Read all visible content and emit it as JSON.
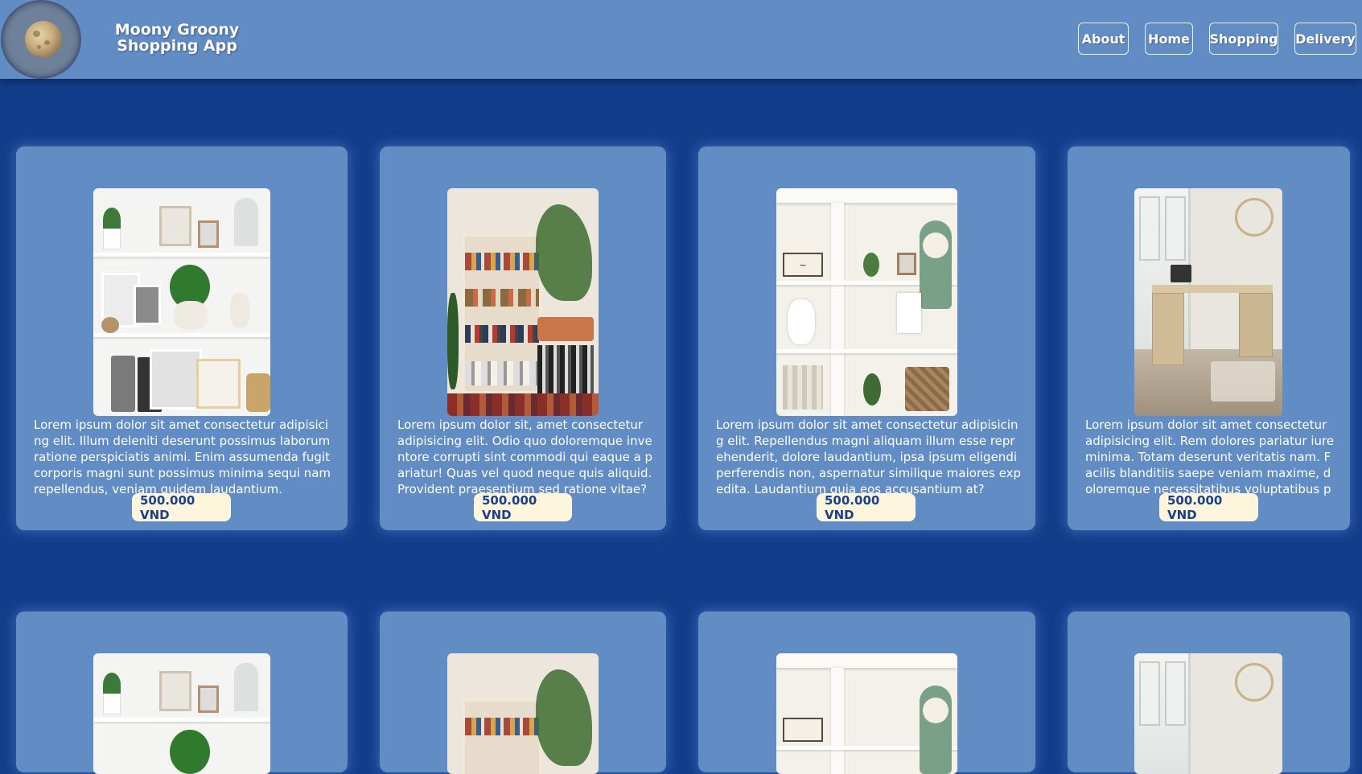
{
  "header": {
    "brand_line1": "Moony Groony",
    "brand_line2": "Shopping App",
    "logo_icon": "moon-logo-icon"
  },
  "nav": {
    "about": "About",
    "home": "Home",
    "shopping": "Shopping",
    "delivery": "Delivery"
  },
  "products": [
    {
      "image": "white-bookshelf-decor",
      "description": "Lorem ipsum dolor sit amet consectetur adipisicing elit. Illum deleniti deserunt possimus laborum ratione perspiciatis animi. Enim assumenda fugit corporis magni sunt possimus minima sequi nam repellendus, veniam quidem laudantium.",
      "price": "500.000 VND"
    },
    {
      "image": "plant-bookshelf",
      "description": "Lorem ipsum dolor sit, amet consectetur adipisicing elit. Odio quo doloremque inventore corrupti sint commodi qui eaque a pariatur! Quas vel quod neque quis aliquid. Provident praesentium sed ratione vitae?",
      "price": "500.000 VND"
    },
    {
      "image": "built-in-shelf-blessed",
      "description": "Lorem ipsum dolor sit amet consectetur adipisicing elit. Repellendus magni aliquam illum esse reprehenderit, dolore laudantium, ipsa ipsum eligendi perferendis non, aspernatur similique maiores expedita. Laudantium quia eos accusantium at?",
      "price": "500.000 VND"
    },
    {
      "image": "corner-desk",
      "description": "Lorem ipsum dolor sit amet consectetur adipisicing elit. Rem dolores pariatur iure minima. Totam deserunt veritatis nam. Facilis blanditiis saepe veniam maxime, doloremque necessitatibus voluptatibus perspiciatis.",
      "price": "500.000 VND"
    }
  ]
}
